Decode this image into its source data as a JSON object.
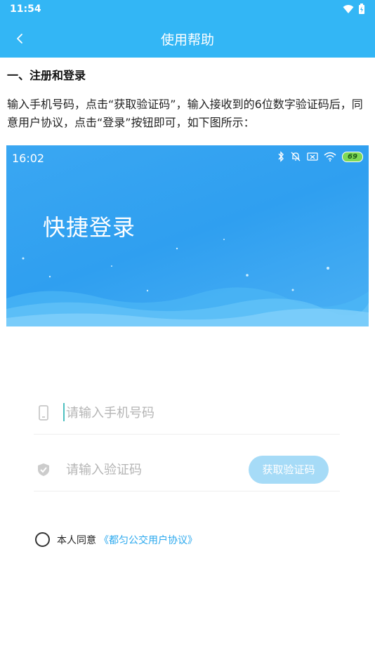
{
  "status_bar": {
    "time": "11:54",
    "icons": [
      "wifi-icon",
      "battery-icon"
    ]
  },
  "app_bar": {
    "title": "使用帮助",
    "back_icon": "chevron-left-icon"
  },
  "article": {
    "heading": "一、注册和登录",
    "paragraph": "输入手机号码，点击“获取验证码”，输入接收到的6位数字验证码后，同意用户协议，点击“登录”按钮即可，如下图所示："
  },
  "screenshot": {
    "status_time": "16:02",
    "battery_level": "69",
    "title": "快捷登录",
    "phone_placeholder": "请输入手机号码",
    "code_placeholder": "请输入验证码",
    "get_code_label": "获取验证码",
    "agree_text": "本人同意",
    "agreement_link": "《都匀公交用户协议》"
  },
  "colors": {
    "primary": "#33b6f5",
    "link": "#2aa8ee",
    "button_disabled": "#a6dbf7"
  }
}
